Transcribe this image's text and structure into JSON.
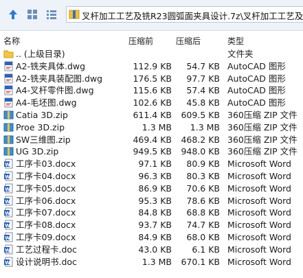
{
  "toolbar": {
    "path": "叉杆加工工艺及铣R23圆弧面夹具设计.7z\\叉杆加工工艺及铣R"
  },
  "columns": {
    "name": "名称",
    "compressed": "压缩前",
    "size": "压缩后",
    "type": "类型"
  },
  "rows": [
    {
      "name": ".. (上级目录)",
      "comp": "",
      "size": "",
      "type": "文件夹",
      "icon": "folder-icon"
    },
    {
      "name": "A2-铣夹具体.dwg",
      "comp": "112.9 KB",
      "size": "54.7 KB",
      "type": "AutoCAD 图形",
      "icon": "dwg-icon"
    },
    {
      "name": "A2-铣夹具装配图.dwg",
      "comp": "176.5 KB",
      "size": "97.7 KB",
      "type": "AutoCAD 图形",
      "icon": "dwg-icon"
    },
    {
      "name": "A4-叉杆零件图.dwg",
      "comp": "115.6 KB",
      "size": "57.4 KB",
      "type": "AutoCAD 图形",
      "icon": "dwg-icon"
    },
    {
      "name": "A4-毛坯图.dwg",
      "comp": "102.6 KB",
      "size": "45.8 KB",
      "type": "AutoCAD 图形",
      "icon": "dwg-icon"
    },
    {
      "name": "Catia 3D.zip",
      "comp": "611.4 KB",
      "size": "609.5 KB",
      "type": "360压缩 ZIP 文件",
      "icon": "zip-icon"
    },
    {
      "name": "Proe 3D.zip",
      "comp": "1.3 MB",
      "size": "1.3 MB",
      "type": "360压缩 ZIP 文件",
      "icon": "zip-icon"
    },
    {
      "name": "SW三维图.zip",
      "comp": "469.4 KB",
      "size": "468.2 KB",
      "type": "360压缩 ZIP 文件",
      "icon": "zip-icon"
    },
    {
      "name": "UG 3D.zip",
      "comp": "949.5 KB",
      "size": "948.0 KB",
      "type": "360压缩 ZIP 文件",
      "icon": "zip-icon"
    },
    {
      "name": "工序卡03.docx",
      "comp": "97.1 KB",
      "size": "80.9 KB",
      "type": "Microsoft Word",
      "icon": "word-icon"
    },
    {
      "name": "工序卡04.docx",
      "comp": "96.3 KB",
      "size": "80.3 KB",
      "type": "Microsoft Word",
      "icon": "word-icon"
    },
    {
      "name": "工序卡05.docx",
      "comp": "86.9 KB",
      "size": "70.6 KB",
      "type": "Microsoft Word",
      "icon": "word-icon"
    },
    {
      "name": "工序卡06.docx",
      "comp": "95.3 KB",
      "size": "78.6 KB",
      "type": "Microsoft Word",
      "icon": "word-icon"
    },
    {
      "name": "工序卡07.docx",
      "comp": "84.8 KB",
      "size": "68.8 KB",
      "type": "Microsoft Word",
      "icon": "word-icon"
    },
    {
      "name": "工序卡08.docx",
      "comp": "93.7 KB",
      "size": "74.7 KB",
      "type": "Microsoft Word",
      "icon": "word-icon"
    },
    {
      "name": "工序卡09.docx",
      "comp": "84.9 KB",
      "size": "68.0 KB",
      "type": "Microsoft Word",
      "icon": "word-icon"
    },
    {
      "name": "工艺过程卡.doc",
      "comp": "43.0 KB",
      "size": "6.1 KB",
      "type": "Microsoft Word",
      "icon": "word-icon"
    },
    {
      "name": "设计说明书.doc",
      "comp": "1.3 MB",
      "size": "670.1 KB",
      "type": "Microsoft Word",
      "icon": "word-icon"
    }
  ]
}
